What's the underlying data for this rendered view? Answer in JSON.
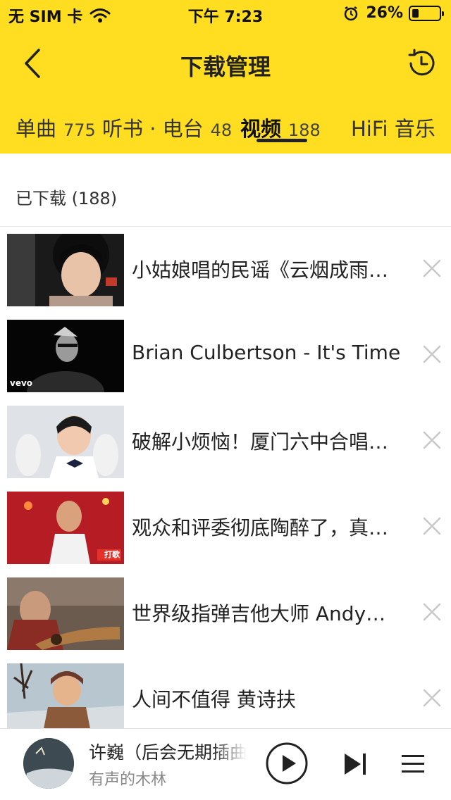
{
  "status": {
    "carrier": "无 SIM 卡",
    "time": "下午 7:23",
    "battery": "26%",
    "battery_level": 0.26
  },
  "nav": {
    "title": "下载管理"
  },
  "tabs": [
    {
      "label": "单曲",
      "count": "775"
    },
    {
      "label": "听书 · 电台",
      "count": "48"
    },
    {
      "label": "视频",
      "count": "188"
    },
    {
      "label": "HiFi 音乐",
      "count": ""
    }
  ],
  "active_tab": "视频",
  "section": {
    "title": "已下载 (188)"
  },
  "videos": [
    {
      "title": "小姑娘唱的民谣《云烟成雨…"
    },
    {
      "title": "Brian Culbertson - It's Time"
    },
    {
      "title": "破解小烦恼！厦门六中合唱…"
    },
    {
      "title": "观众和评委彻底陶醉了，真…"
    },
    {
      "title": "世界级指弹吉他大师 Andy…"
    },
    {
      "title": "人间不值得 黄诗扶"
    }
  ],
  "thumb_overlays": {
    "vevo": "vevo",
    "show": "打歌"
  },
  "player": {
    "song": "许巍（后会无期插曲",
    "artist": "有声的木林"
  },
  "colors": {
    "accent": "#FFDE22",
    "text": "#222222",
    "muted": "#888888"
  }
}
